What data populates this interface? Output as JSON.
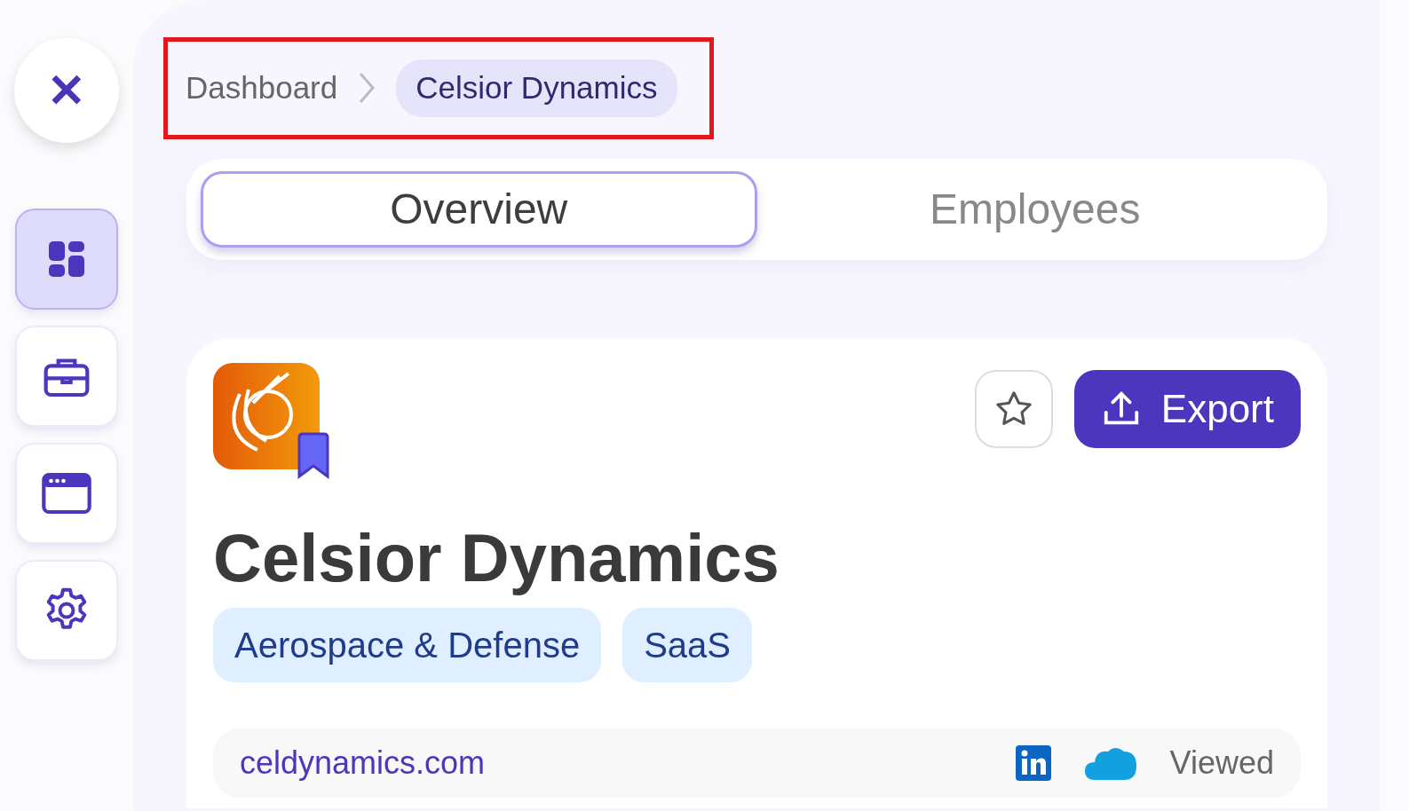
{
  "sidebar": {
    "close_label": "✕",
    "items": [
      {
        "kind": "dashboard",
        "selected": true
      },
      {
        "kind": "briefcase",
        "selected": false
      },
      {
        "kind": "window",
        "selected": false
      },
      {
        "kind": "settings",
        "selected": false
      }
    ]
  },
  "breadcrumb": {
    "items": [
      {
        "label": "Dashboard",
        "current": false
      },
      {
        "label": "Celsior Dynamics",
        "current": true
      }
    ]
  },
  "tabs": [
    {
      "label": "Overview",
      "selected": true
    },
    {
      "label": "Employees",
      "selected": false
    }
  ],
  "company": {
    "name": "Celsior Dynamics",
    "tags": [
      "Aerospace & Defense",
      "SaaS"
    ],
    "export_label": "Export",
    "website": "celdynamics.com",
    "status": "Viewed"
  }
}
